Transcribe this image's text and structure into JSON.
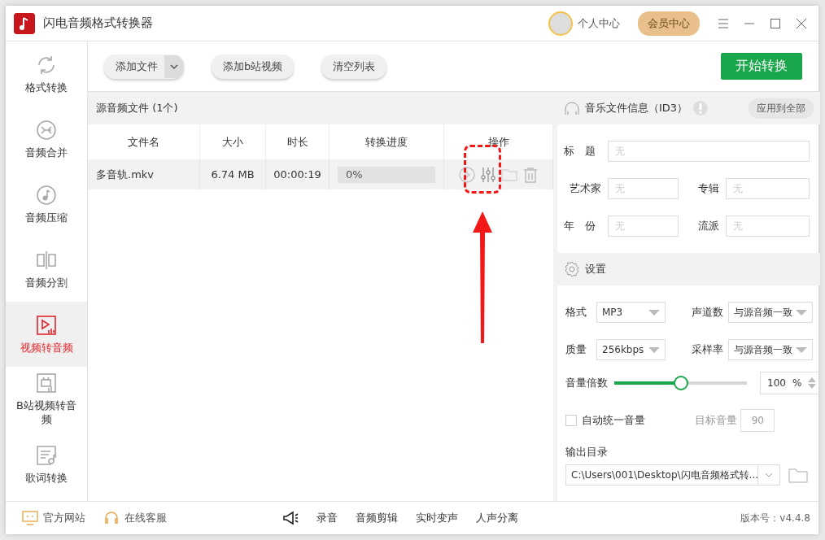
{
  "window": {
    "title": "闪电音频格式转换器",
    "user_label": "个人中心",
    "vip_button": "会员中心"
  },
  "sidebar": {
    "items": [
      {
        "label": "格式转换",
        "kind": "convert",
        "selected": false
      },
      {
        "label": "音频合并",
        "kind": "merge",
        "selected": false
      },
      {
        "label": "音频压缩",
        "kind": "note",
        "selected": false
      },
      {
        "label": "音频分割",
        "kind": "split",
        "selected": false
      },
      {
        "label": "视频转音频",
        "kind": "video",
        "selected": true
      },
      {
        "label": "B站视频转音频",
        "kind": "tv",
        "selected": false
      },
      {
        "label": "歌词转换",
        "kind": "lyrics",
        "selected": false
      }
    ]
  },
  "toolbar": {
    "add_file": "添加文件",
    "add_bilibili": "添加b站视频",
    "clear_list": "清空列表",
    "start": "开始转换"
  },
  "file_list": {
    "title": "源音频文件 (1个)",
    "columns": [
      "文件名",
      "大小",
      "时长",
      "转换进度",
      "操作"
    ],
    "rows": [
      {
        "name": "多音轨.mkv",
        "size": "6.74 MB",
        "duration": "00:00:19",
        "progress_text": "0%",
        "level": 0
      }
    ]
  },
  "id3": {
    "title": "音乐文件信息（ID3）",
    "apply_all": "应用到全部",
    "fields": [
      {
        "label": "标　题",
        "placeholder": "无"
      },
      {
        "label": "艺术家",
        "placeholder": "无"
      },
      {
        "label": "专辑",
        "placeholder": "无"
      },
      {
        "label": "年　份",
        "placeholder": "无"
      },
      {
        "label": "流派",
        "placeholder": "无"
      }
    ]
  },
  "settings": {
    "title": "设置",
    "selects": [
      {
        "label": "格式",
        "value": "MP3"
      },
      {
        "label": "声道数",
        "value": "与源音频一致"
      },
      {
        "label": "质量",
        "value": "256kbps"
      },
      {
        "label": "采样率",
        "value": "与源音频一致"
      }
    ],
    "volume": {
      "label": "音量倍数",
      "level": 0.5,
      "value": "100",
      "unit": "%"
    },
    "auto_volume": {
      "label": "自动统一音量",
      "checked": false,
      "target_label": "目标音量",
      "target_value": "90"
    },
    "output": {
      "label": "输出目录",
      "path": "C:\\Users\\001\\Desktop\\闪电音频格式转..."
    }
  },
  "footer": {
    "links": [
      "官方网站",
      "在线客服"
    ],
    "tools": [
      "录音",
      "音频剪辑",
      "实时变声",
      "人声分离"
    ],
    "version": "版本号：v4.4.8"
  }
}
